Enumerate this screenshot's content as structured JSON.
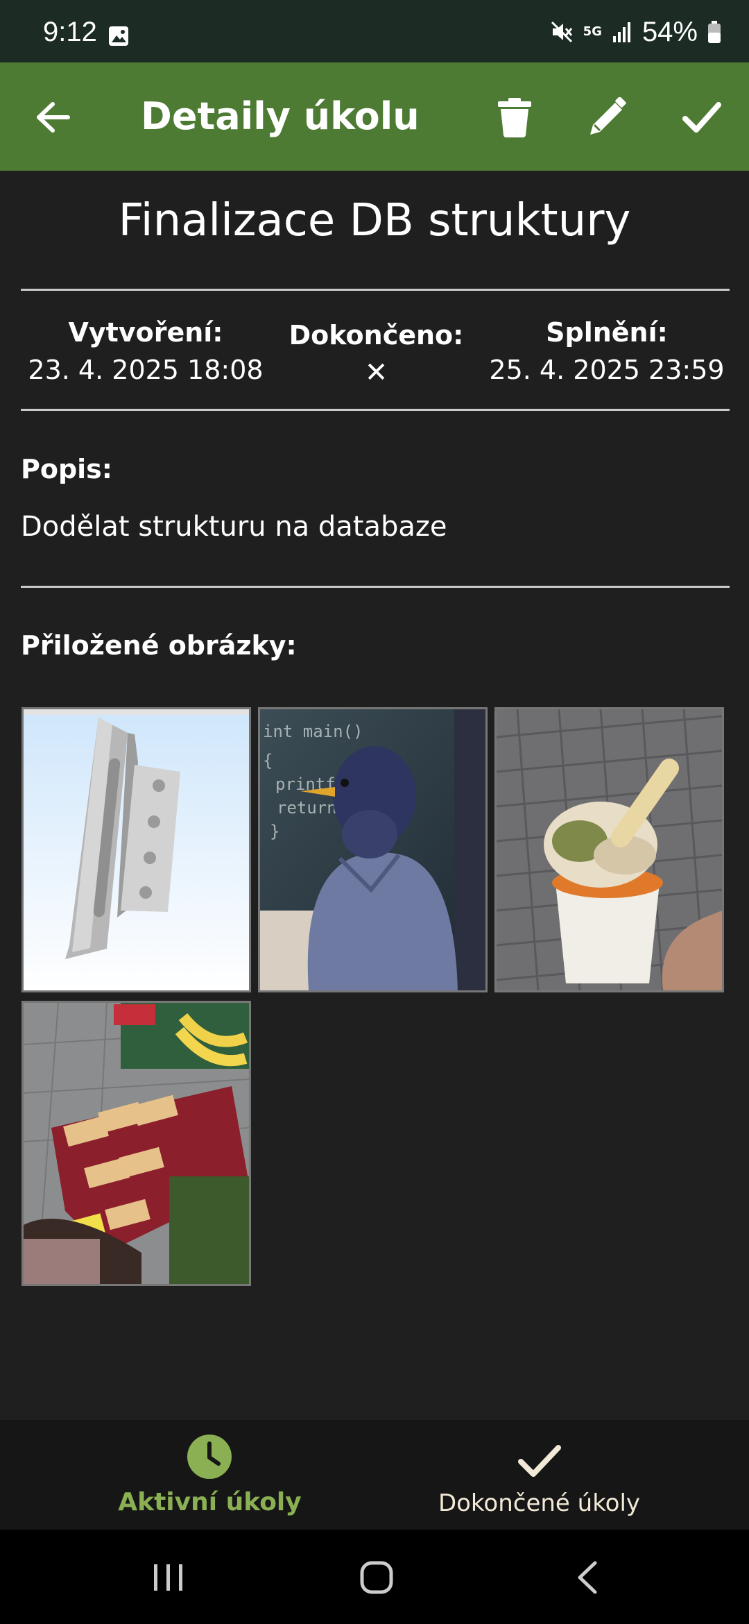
{
  "status_bar": {
    "time": "9:12",
    "network": "5G",
    "battery": "54%"
  },
  "app_bar": {
    "title": "Detaily úkolu",
    "icons": [
      "back-arrow-icon",
      "trash-icon",
      "pencil-icon",
      "checkmark-icon"
    ]
  },
  "task": {
    "title": "Finalizace DB struktury",
    "created_label": "Vytvoření:",
    "created_value": "23. 4. 2025 18:08",
    "done_label": "Dokončeno:",
    "done_value": "✕",
    "due_label": "Splnění:",
    "due_value": "25. 4. 2025 23:59",
    "description_label": "Popis:",
    "description": "Dodělat strukturu na databaze",
    "images_label": "Přiložené obrázky:"
  },
  "images": [
    "cad-bracket-render",
    "bird-programmer",
    "ice-cream-cup",
    "supermarket-shelf"
  ],
  "bottom_nav": {
    "active_label": "Aktivní úkoly",
    "done_label": "Dokončené úkoly"
  },
  "colors": {
    "app_bar": "#4e7b33",
    "status_bar": "#1c2c25",
    "background": "#1f1f1f",
    "nav_active": "#8bb053",
    "nav_inactive": "#f2e9d6"
  }
}
